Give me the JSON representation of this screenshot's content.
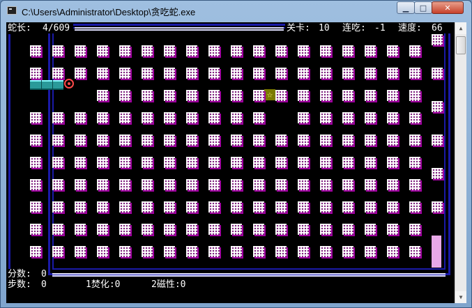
{
  "window": {
    "title": "C:\\Users\\Administrator\\Desktop\\贪吃蛇.exe"
  },
  "hud": {
    "snake_length_label": "蛇长:",
    "snake_length_value": "4/609",
    "level_label": "关卡:",
    "level_value": "10",
    "combo_label": "连吃:",
    "combo_value": "-1",
    "speed_label": "速度:",
    "speed_value": "66"
  },
  "footer": {
    "score_label": "分数:",
    "score_value": "0",
    "steps_label": "步数:",
    "steps_value": "0",
    "item1": "1焚化:0",
    "item2": "2磁性:0"
  },
  "colors": {
    "wall": "#1a1aa8",
    "snake": "#2a9a9a",
    "head": "#ff4a4a",
    "pellet_shadow": "#a000a0"
  },
  "icons": {
    "snake_head": "snake-head-icon",
    "food": "star-food-icon"
  }
}
